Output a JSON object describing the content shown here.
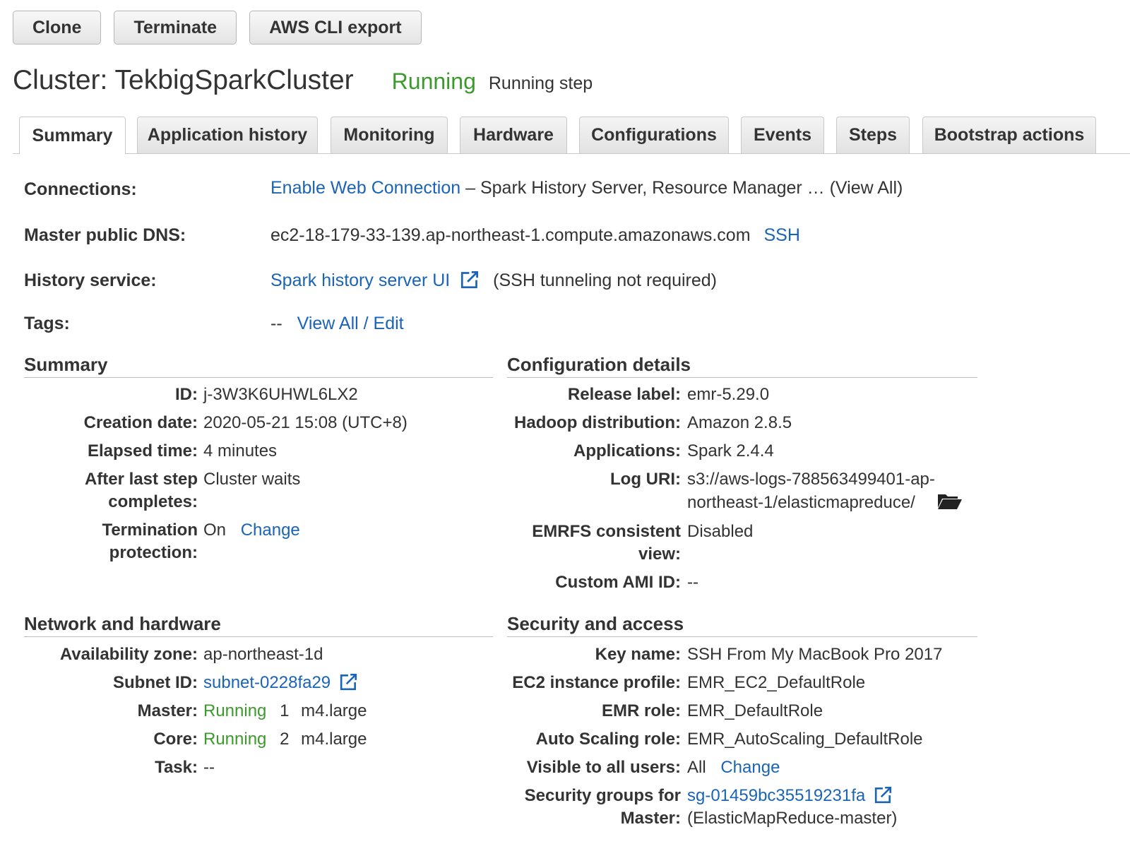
{
  "toolbar": {
    "clone": "Clone",
    "terminate": "Terminate",
    "cli_export": "AWS CLI export"
  },
  "header": {
    "cluster_title": "Cluster: TekbigSparkCluster",
    "status": "Running",
    "status_detail": "Running step"
  },
  "tabs": [
    "Summary",
    "Application history",
    "Monitoring",
    "Hardware",
    "Configurations",
    "Events",
    "Steps",
    "Bootstrap actions"
  ],
  "info": {
    "connections_label": "Connections:",
    "connections_link": "Enable Web Connection",
    "connections_rest": "– Spark History Server, Resource Manager … (View All)",
    "dns_label": "Master public DNS:",
    "dns_value": "ec2-18-179-33-139.ap-northeast-1.compute.amazonaws.com",
    "dns_ssh": "SSH",
    "history_label": "History service:",
    "history_link": "Spark history server UI",
    "history_note": "(SSH tunneling not required)",
    "tags_label": "Tags:",
    "tags_value": "--",
    "tags_link": "View All / Edit"
  },
  "summary": {
    "heading": "Summary",
    "id_label": "ID:",
    "id_value": "j-3W3K6UHWL6LX2",
    "created_label": "Creation date:",
    "created_value": "2020-05-21 15:08 (UTC+8)",
    "elapsed_label": "Elapsed time:",
    "elapsed_value": "4 minutes",
    "after_label_1": "After last step",
    "after_label_2": "completes:",
    "after_value": "Cluster waits",
    "term_label_1": "Termination",
    "term_label_2": "protection:",
    "term_value": "On",
    "term_change": "Change"
  },
  "config": {
    "heading": "Configuration details",
    "release_label": "Release label:",
    "release_value": "emr-5.29.0",
    "hadoop_label": "Hadoop distribution:",
    "hadoop_value": "Amazon 2.8.5",
    "apps_label": "Applications:",
    "apps_value": "Spark 2.4.4",
    "log_label": "Log URI:",
    "log_value_1": "s3://aws-logs-788563499401-ap-",
    "log_value_2": "northeast-1/elasticmapreduce/",
    "emrfs_label_1": "EMRFS consistent",
    "emrfs_label_2": "view:",
    "emrfs_value": "Disabled",
    "ami_label": "Custom AMI ID:",
    "ami_value": "--"
  },
  "network": {
    "heading": "Network and hardware",
    "az_label": "Availability zone:",
    "az_value": "ap-northeast-1d",
    "subnet_label": "Subnet ID:",
    "subnet_value": "subnet-0228fa29",
    "master_label": "Master:",
    "master_status": "Running",
    "master_count": "1",
    "master_type": "m4.large",
    "core_label": "Core:",
    "core_status": "Running",
    "core_count": "2",
    "core_type": "m4.large",
    "task_label": "Task:",
    "task_value": "--"
  },
  "security": {
    "heading": "Security and access",
    "key_label": "Key name:",
    "key_value": "SSH From My MacBook Pro 2017",
    "ec2_label": "EC2 instance profile:",
    "ec2_value": "EMR_EC2_DefaultRole",
    "emr_role_label": "EMR role:",
    "emr_role_value": "EMR_DefaultRole",
    "asg_label": "Auto Scaling role:",
    "asg_value": "EMR_AutoScaling_DefaultRole",
    "visible_label": "Visible to all users:",
    "visible_value": "All",
    "visible_change": "Change",
    "sg_label_1": "Security groups for",
    "sg_label_2": "Master:",
    "sg_value": "sg-01459bc35519231fa",
    "sg_name": "(ElasticMapReduce-master)"
  },
  "colors": {
    "link": "#1a64b8",
    "running": "#3c9a2c",
    "text": "#333333"
  }
}
